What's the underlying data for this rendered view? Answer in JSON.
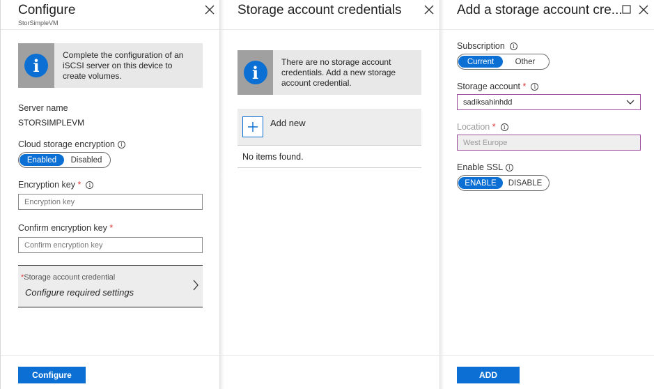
{
  "configure_blade": {
    "title": "Configure",
    "subtitle": "StorSimpleVM",
    "info_text": "Complete the configuration of an iSCSI server on this device to create volumes.",
    "server_name_label": "Server name",
    "server_name_value": "STORSIMPLEVM",
    "cloud_encryption_label": "Cloud storage encryption",
    "cloud_encryption_options": [
      "Enabled",
      "Disabled"
    ],
    "cloud_encryption_selected": "Enabled",
    "encryption_key_label": "Encryption key",
    "encryption_key_placeholder": "Encryption key",
    "confirm_key_label": "Confirm encryption key",
    "confirm_key_placeholder": "Confirm encryption key",
    "storage_credential_label": "Storage account credential",
    "storage_credential_value": "Configure required settings",
    "required_mark": "*",
    "configure_button": "Configure"
  },
  "credentials_blade": {
    "title": "Storage account credentials",
    "info_text": "There are no storage account credentials. Add a new storage account credential.",
    "add_new_label": "Add new",
    "empty_text": "No items found."
  },
  "add_blade": {
    "title": "Add a storage account cre...",
    "subscription_label": "Subscription",
    "subscription_options": [
      "Current",
      "Other"
    ],
    "subscription_selected": "Current",
    "storage_account_label": "Storage account",
    "storage_account_value": "sadiksahinhdd",
    "location_label": "Location",
    "location_value": "West Europe",
    "enable_ssl_label": "Enable SSL",
    "ssl_options": [
      "ENABLE",
      "DISABLE"
    ],
    "ssl_selected": "ENABLE",
    "required_mark": "*",
    "add_button": "ADD"
  },
  "icons": {
    "info": "info-icon",
    "close": "close-icon",
    "maximize": "maximize-icon",
    "chevron": "chevron-right-icon",
    "dropdown": "chevron-down-icon",
    "add": "plus-icon"
  },
  "colors": {
    "accent": "#0b6fd4",
    "required": "#d93a3a",
    "focus_border": "#9b4d9b",
    "info_bg": "#e8e8e8",
    "info_icon_bg": "#a0a0a0"
  }
}
